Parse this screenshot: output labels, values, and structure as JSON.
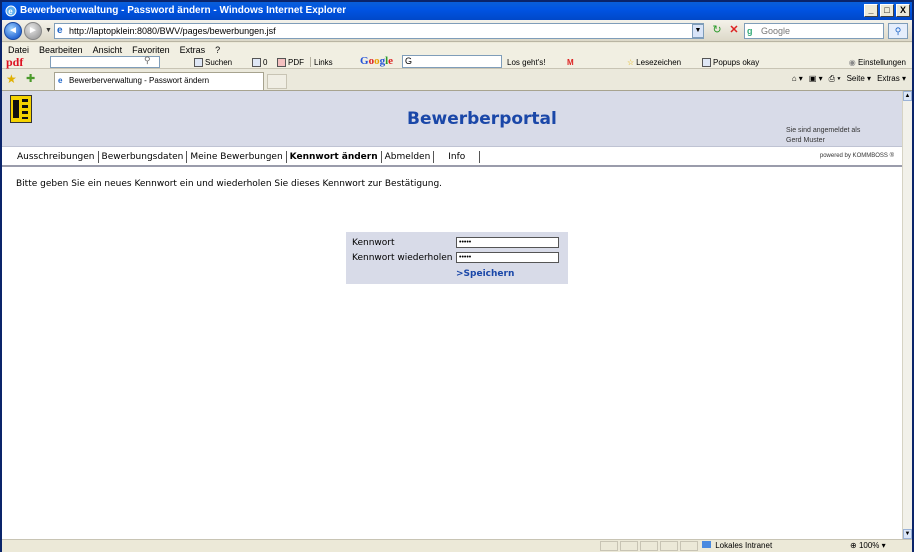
{
  "window": {
    "title": "Bewerberverwaltung - Password ändern - Windows Internet Explorer",
    "min": "_",
    "max": "□",
    "close": "X"
  },
  "address": {
    "url": "http://laptopklein:8080/BWV/pages/bewerbungen.jsf",
    "search_placeholder": "Google"
  },
  "menu": {
    "items": [
      "Datei",
      "Bearbeiten",
      "Ansicht",
      "Favoriten",
      "Extras",
      "?"
    ]
  },
  "toolbar": {
    "pdf_label": "pdf",
    "suchen": "Suchen",
    "count": "0",
    "pdf_btn": "PDF",
    "links": "Links",
    "google": "Google",
    "google_box": "G",
    "losgehts": "Los geht's!",
    "lesezeichen": "Lesezeichen",
    "popups": "Popups okay",
    "einstellungen": "Einstellungen"
  },
  "tabs": {
    "active_label": "Bewerberverwaltung - Passwort ändern",
    "cmd_seite": "Seite",
    "cmd_extras": "Extras"
  },
  "portal": {
    "title": "Bewerberportal",
    "login_line1": "Sie sind angemeldet als",
    "login_line2": "Gerd Muster",
    "powered": "powered by KOMMBOSS ®",
    "nav": [
      "Ausschreibungen",
      "Bewerbungsdaten",
      "Meine Bewerbungen",
      "Kennwort ändern",
      "Abmelden",
      "Info"
    ],
    "instruction": "Bitte geben Sie ein neues Kennwort ein und wiederholen Sie dieses Kennwort zur Bestätigung.",
    "form": {
      "label_password": "Kennwort",
      "label_repeat": "Kennwort wiederholen",
      "value_password": "•••••",
      "value_repeat": "•••••",
      "save": ">Speichern"
    }
  },
  "status": {
    "zone": "Lokales Intranet",
    "zoom": "100%"
  },
  "colors": {
    "portal_bg": "#d8dbe8",
    "title_blue": "#1a47a8",
    "titlebar": "#0054e3"
  }
}
